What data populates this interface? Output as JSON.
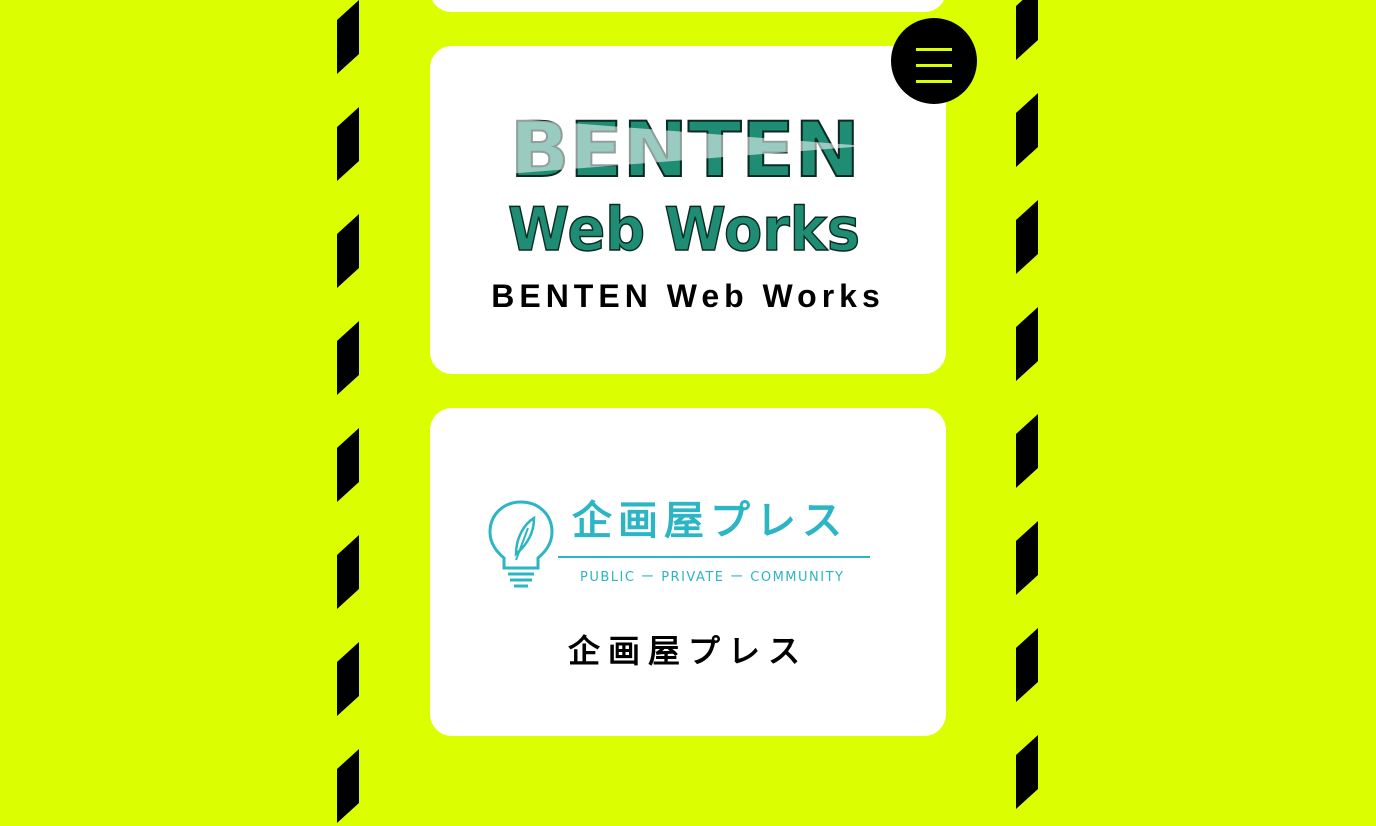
{
  "colors": {
    "background": "#dcff00",
    "stripe": "#000000",
    "card": "#ffffff",
    "benten_green": "#1f8c74",
    "kikakuya_teal": "#2bb5c5"
  },
  "menu": {
    "icon": "hamburger-icon"
  },
  "cards": [
    {
      "logo_word": "BENTEN",
      "logo_sub": "Web Works",
      "title": "BENTEN Web Works"
    },
    {
      "logo_word": "企画屋プレス",
      "logo_sub": "PUBLIC ー PRIVATE ー COMMUNITY",
      "logo_icon": "lightbulb-icon",
      "title": "企画屋プレス"
    }
  ]
}
